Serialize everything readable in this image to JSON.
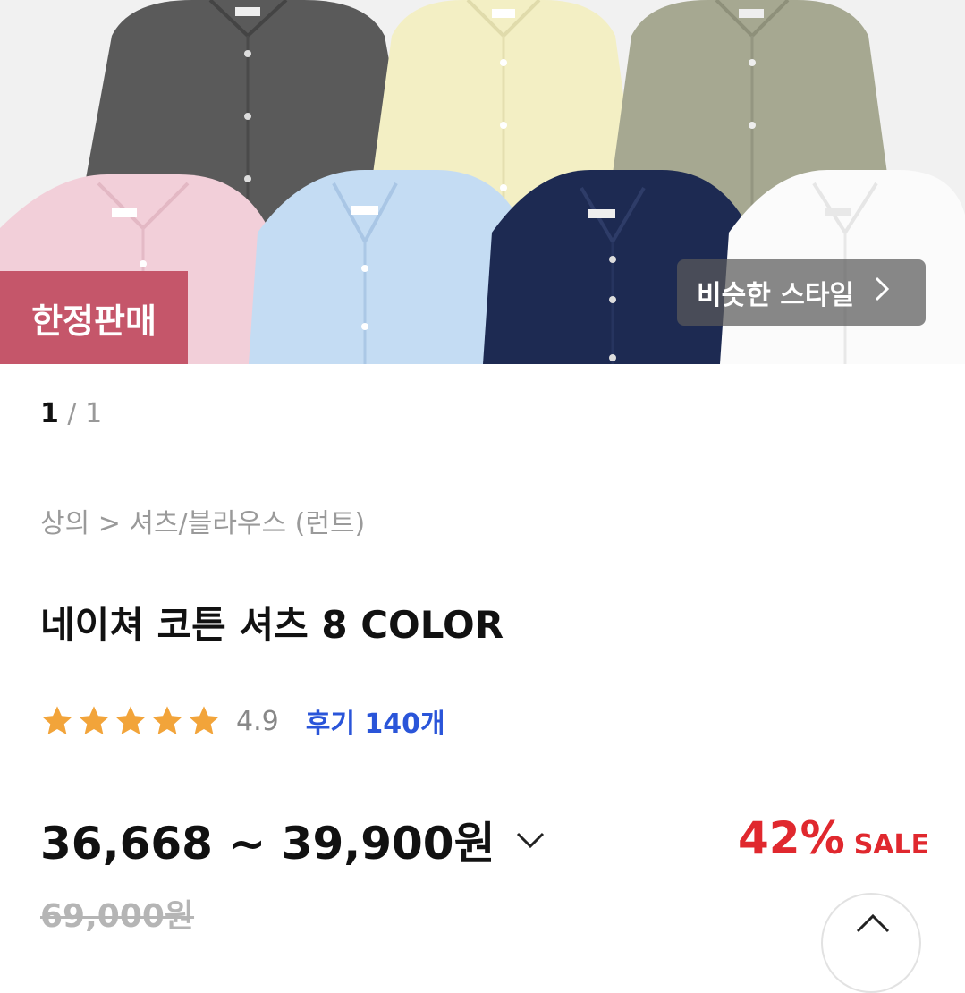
{
  "hero": {
    "shirts": [
      {
        "name": "charcoal",
        "color": "#5a5a5a"
      },
      {
        "name": "butter",
        "color": "#f3efc4"
      },
      {
        "name": "sage",
        "color": "#a6a891"
      },
      {
        "name": "pink",
        "color": "#f2cfd9"
      },
      {
        "name": "sky-blue",
        "color": "#c4dcf3"
      },
      {
        "name": "navy",
        "color": "#1d2a52"
      },
      {
        "name": "white",
        "color": "#fbfbfb"
      }
    ],
    "limited_badge": "한정판매",
    "similar_style": "비슷한 스타일"
  },
  "pager": {
    "current": "1",
    "separator": " / ",
    "total": "1"
  },
  "breadcrumb": "상의 > 셔츠/블라우스 (런트)",
  "product": {
    "title": "네이쳐 코튼 셔츠 8 COLOR",
    "rating": 4.9,
    "rating_text": "4.9",
    "reviews": "후기 140개",
    "price_range": "36,668 ~ 39,900원",
    "discount_pct": "42%",
    "sale_label": "SALE",
    "original_price": "69,000원"
  },
  "colors": {
    "badge": "#c5566a",
    "review_link": "#2a55d9",
    "sale": "#e0282e",
    "star": "#f2a43a"
  },
  "icons": {
    "similar": "chevron-right-icon",
    "price_toggle": "chevron-down-icon",
    "scroll_top": "chevron-up-icon"
  }
}
